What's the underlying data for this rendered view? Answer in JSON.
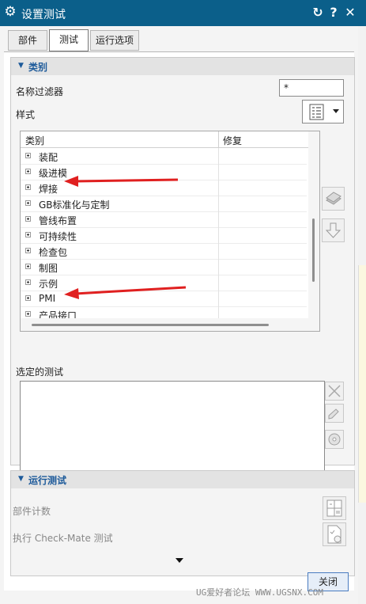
{
  "window": {
    "title": "设置测试",
    "refresh_icon": "refresh-icon",
    "help_label": "?",
    "close_icon": "close-icon",
    "title_icon": "gear-icon"
  },
  "tabs": [
    {
      "label": "部件",
      "active": false
    },
    {
      "label": "测试",
      "active": true
    },
    {
      "label": "运行选项",
      "active": false
    }
  ],
  "category_group": {
    "title": "类别",
    "name_filter_label": "名称过滤器",
    "name_filter_value": "*",
    "style_label": "样式",
    "tree": {
      "columns": [
        "类别",
        "修复"
      ],
      "items": [
        {
          "label": "装配"
        },
        {
          "label": "级进模"
        },
        {
          "label": "焊接"
        },
        {
          "label": "GB标准化与定制"
        },
        {
          "label": "管线布置"
        },
        {
          "label": "可持续性"
        },
        {
          "label": "检查包"
        },
        {
          "label": "制图"
        },
        {
          "label": "示例"
        },
        {
          "label": "PMI"
        },
        {
          "label": "产品接口"
        }
      ]
    },
    "selected_tests_label": "选定的测试"
  },
  "run_group": {
    "title": "运行测试",
    "part_count_label": "部件计数",
    "run_checkmate_label": "执行 Check-Mate 测试"
  },
  "footer": {
    "close_label": "关闭",
    "watermark": "UG爱好者论坛 WWW.UGSNX.COM"
  },
  "colors": {
    "titlebar": "#0b5f8a",
    "section_title": "#1d5a9a",
    "annotation_arrow": "#e02020"
  }
}
